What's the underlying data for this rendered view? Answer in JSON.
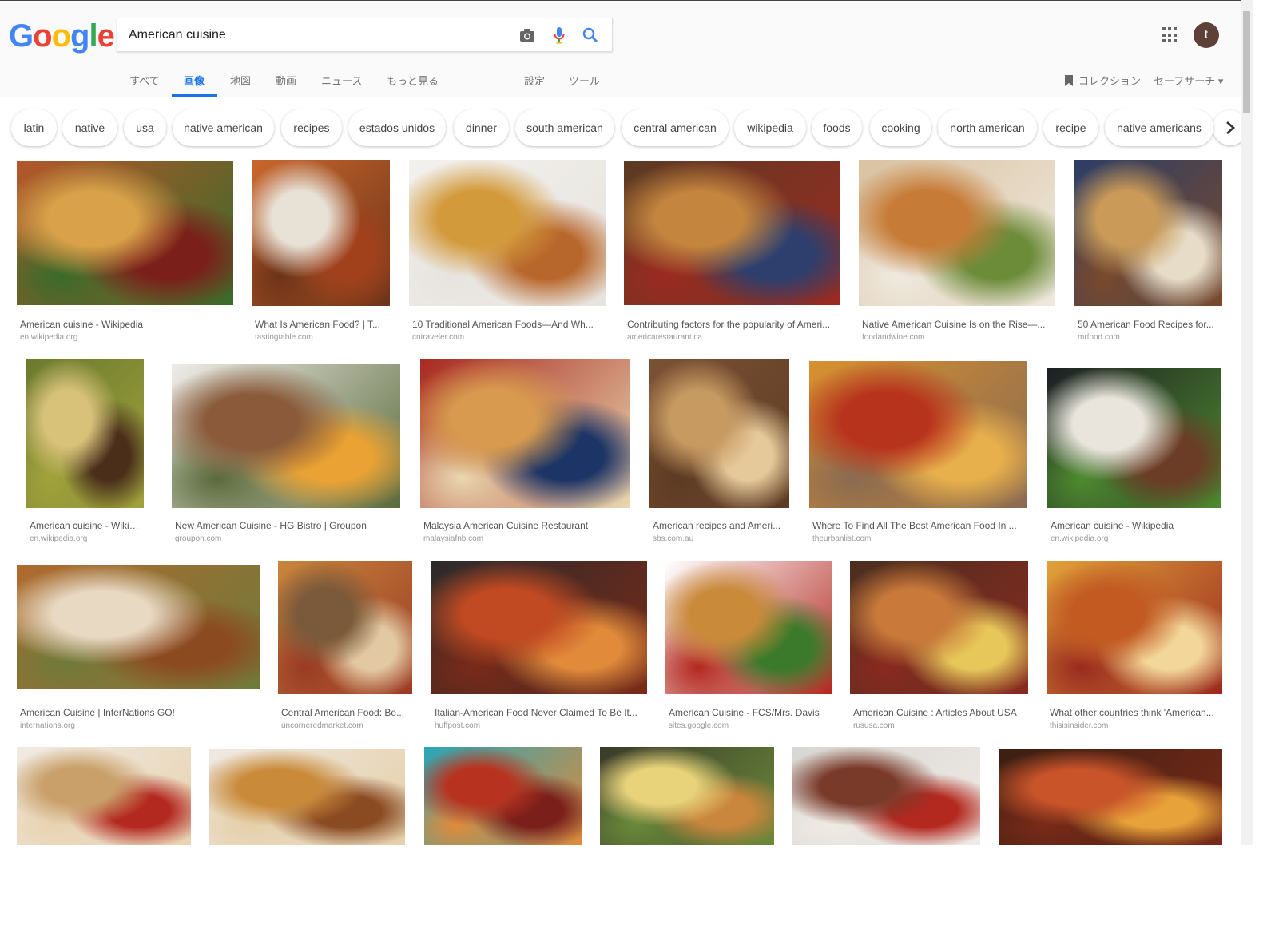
{
  "header": {
    "logo_letters": [
      {
        "ch": "G",
        "color": "#4285f4"
      },
      {
        "ch": "o",
        "color": "#ea4335"
      },
      {
        "ch": "o",
        "color": "#fbbc05"
      },
      {
        "ch": "g",
        "color": "#4285f4"
      },
      {
        "ch": "l",
        "color": "#34a853"
      },
      {
        "ch": "e",
        "color": "#ea4335"
      }
    ],
    "search_query": "American cuisine",
    "avatar_letter": "t"
  },
  "tabs": [
    "すべて",
    "画像",
    "地図",
    "動画",
    "ニュース",
    "もっと見る",
    "設定",
    "ツール"
  ],
  "active_tab": "画像",
  "collections_label": "コレクション",
  "safesearch_label": "セーフサーチ ▾",
  "chips": [
    "latin",
    "native",
    "usa",
    "native american",
    "recipes",
    "estados unidos",
    "dinner",
    "south american",
    "central american",
    "wikipedia",
    "foods",
    "cooking",
    "north american",
    "recipe",
    "native americans"
  ],
  "results": [
    {
      "title": "American cuisine - Wikipedia",
      "source": "en.wikipedia.org",
      "colors": [
        "#b5562a",
        "#d9a24a",
        "#7a1f1a",
        "#3a6b2a"
      ]
    },
    {
      "title": "What Is American Food? | T...",
      "source": "tastingtable.com",
      "colors": [
        "#c9672d",
        "#e8e1d5",
        "#a0411c",
        "#6e3318"
      ]
    },
    {
      "title": "10 Traditional American Foods—And Wh...",
      "source": "cntraveler.com",
      "colors": [
        "#f3f1ee",
        "#d39a3b",
        "#b8672c",
        "#e7e4df"
      ]
    },
    {
      "title": "Contributing factors for the popularity of Ameri...",
      "source": "americarestaurant.ca",
      "colors": [
        "#5b3b22",
        "#c4863f",
        "#2e3f6e",
        "#9b2a22"
      ]
    },
    {
      "title": "Native American Cuisine Is on the Rise—...",
      "source": "foodandwine.com",
      "colors": [
        "#d9c2a0",
        "#c67b36",
        "#6d8c3a",
        "#efe9df"
      ]
    },
    {
      "title": "50 American Food Recipes for...",
      "source": "mrfood.com",
      "colors": [
        "#2c3e66",
        "#c99a58",
        "#e7dcc7",
        "#7a4a2b"
      ]
    },
    {
      "title": "American cuisine - Wikipedia",
      "source": "en.wikipedia.org",
      "colors": [
        "#6a7a2e",
        "#d8c27a",
        "#4a2e1a",
        "#a2a23c"
      ]
    },
    {
      "title": "New American Cuisine - HG Bistro | Groupon",
      "source": "groupon.com",
      "colors": [
        "#efece8",
        "#8a5a3a",
        "#e9a233",
        "#5a6a3a"
      ]
    },
    {
      "title": "Malaysia American Cuisine Restaurant",
      "source": "malaysiafnb.com",
      "colors": [
        "#a8281f",
        "#d79a4e",
        "#1d3566",
        "#e9d7b0"
      ]
    },
    {
      "title": "American recipes and Ameri...",
      "source": "sbs.com.au",
      "colors": [
        "#7a5134",
        "#c79a62",
        "#e6c99a",
        "#5d3b23"
      ]
    },
    {
      "title": "Where To Find All The Best American Food In ...",
      "source": "theurbanlist.com",
      "colors": [
        "#d8912f",
        "#b8331c",
        "#e7b04c",
        "#8a6a52"
      ]
    },
    {
      "title": "American cuisine - Wikipedia",
      "source": "en.wikipedia.org",
      "colors": [
        "#1d1f24",
        "#e9e5dc",
        "#6b3d26",
        "#4e8a2f"
      ]
    },
    {
      "title": "American Cuisine | InterNations GO!",
      "source": "internations.org",
      "colors": [
        "#b06a2e",
        "#e8d9c3",
        "#8c4a20",
        "#6f7a3a"
      ]
    },
    {
      "title": "Central American Food: Be...",
      "source": "uncorneredmarket.com",
      "colors": [
        "#c9863d",
        "#7a5a3a",
        "#e3c9a3",
        "#9a3a24"
      ]
    },
    {
      "title": "Italian-American Food Never Claimed To Be It...",
      "source": "huffpost.com",
      "colors": [
        "#2b2b2b",
        "#c24a22",
        "#e08a3a",
        "#7a2a18"
      ]
    },
    {
      "title": "American Cuisine - FCS/Mrs. Davis",
      "source": "sites.google.com",
      "colors": [
        "#ffffff",
        "#c98a3a",
        "#3a7a2a",
        "#b3281f"
      ]
    },
    {
      "title": "American Cuisine : Articles About USA",
      "source": "rususa.com",
      "colors": [
        "#4a2e1f",
        "#c97a3a",
        "#e7c75a",
        "#8a2a1f"
      ]
    },
    {
      "title": "What other countries think 'American...",
      "source": "thisisinsider.com",
      "colors": [
        "#e2a23a",
        "#c25a22",
        "#f3d79a",
        "#9a2a1f"
      ]
    },
    {
      "title": "",
      "source": "",
      "colors": [
        "#f0ebe4",
        "#c9a06a",
        "#b3281f",
        "#e8d2b0"
      ]
    },
    {
      "title": "",
      "source": "",
      "colors": [
        "#efe9e2",
        "#c98a3a",
        "#8a4a22",
        "#e5cfa8"
      ]
    },
    {
      "title": "",
      "source": "",
      "colors": [
        "#2aa6b8",
        "#b8331f",
        "#7a1f1a",
        "#e08a3a"
      ]
    },
    {
      "title": "",
      "source": "",
      "colors": [
        "#3a3a2a",
        "#e8d27a",
        "#c9863d",
        "#6a8a3a"
      ]
    },
    {
      "title": "",
      "source": "",
      "colors": [
        "#d8d6d2",
        "#7a3a2a",
        "#b3281f",
        "#efeae4"
      ]
    },
    {
      "title": "",
      "source": "",
      "colors": [
        "#3a1f12",
        "#c9542a",
        "#e8a23a",
        "#7a2a18"
      ]
    }
  ]
}
